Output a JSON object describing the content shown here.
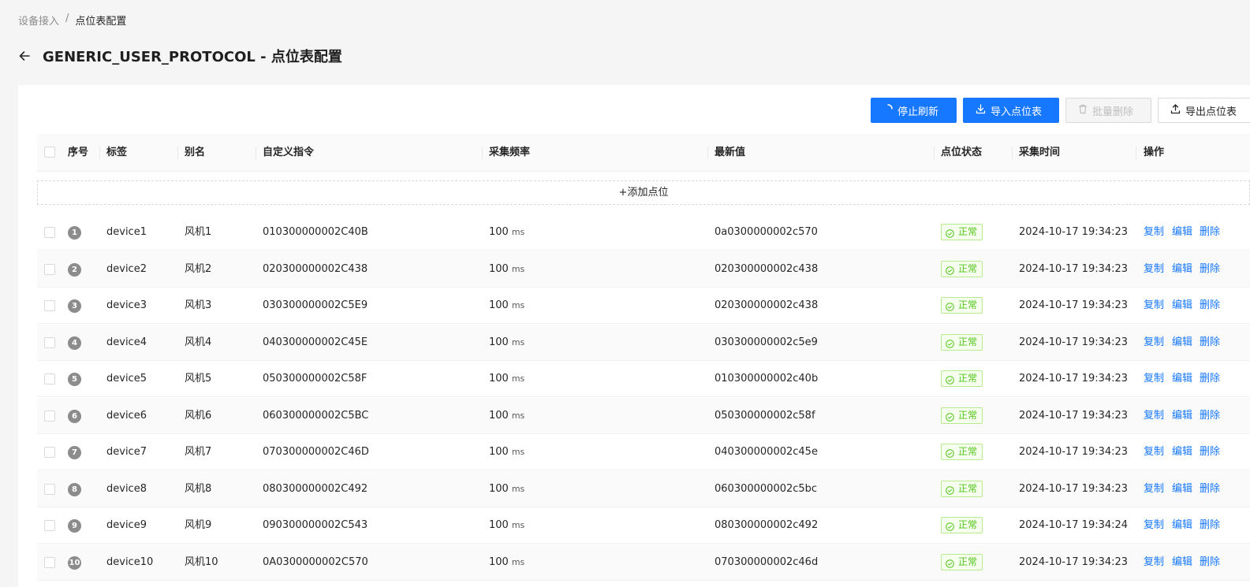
{
  "breadcrumb": {
    "parent": "设备接入",
    "separator": "/",
    "current": "点位表配置"
  },
  "page": {
    "title": "GENERIC_USER_PROTOCOL - 点位表配置"
  },
  "toolbar": {
    "stop_refresh": "停止刷新",
    "import": "导入点位表",
    "batch_delete": "批量删除",
    "export": "导出点位表"
  },
  "table": {
    "columns": [
      "序号",
      "标签",
      "别名",
      "自定义指令",
      "采集频率",
      "最新值",
      "点位状态",
      "采集时间",
      "操作"
    ],
    "add_label": "+添加点位",
    "unit": "ms",
    "actions": {
      "copy": "复制",
      "edit": "编辑",
      "delete": "删除"
    },
    "rows": [
      {
        "idx": "1",
        "tag": "device1",
        "alias": "风机1",
        "cmd": "010300000002C40B",
        "freq": "100",
        "value": "0a0300000002c570",
        "status": "正常",
        "time": "2024-10-17 19:34:23"
      },
      {
        "idx": "2",
        "tag": "device2",
        "alias": "风机2",
        "cmd": "020300000002C438",
        "freq": "100",
        "value": "020300000002c438",
        "status": "正常",
        "time": "2024-10-17 19:34:23"
      },
      {
        "idx": "3",
        "tag": "device3",
        "alias": "风机3",
        "cmd": "030300000002C5E9",
        "freq": "100",
        "value": "020300000002c438",
        "status": "正常",
        "time": "2024-10-17 19:34:23"
      },
      {
        "idx": "4",
        "tag": "device4",
        "alias": "风机4",
        "cmd": "040300000002C45E",
        "freq": "100",
        "value": "030300000002c5e9",
        "status": "正常",
        "time": "2024-10-17 19:34:23"
      },
      {
        "idx": "5",
        "tag": "device5",
        "alias": "风机5",
        "cmd": "050300000002C58F",
        "freq": "100",
        "value": "010300000002c40b",
        "status": "正常",
        "time": "2024-10-17 19:34:23"
      },
      {
        "idx": "6",
        "tag": "device6",
        "alias": "风机6",
        "cmd": "060300000002C5BC",
        "freq": "100",
        "value": "050300000002c58f",
        "status": "正常",
        "time": "2024-10-17 19:34:23"
      },
      {
        "idx": "7",
        "tag": "device7",
        "alias": "风机7",
        "cmd": "070300000002C46D",
        "freq": "100",
        "value": "040300000002c45e",
        "status": "正常",
        "time": "2024-10-17 19:34:23"
      },
      {
        "idx": "8",
        "tag": "device8",
        "alias": "风机8",
        "cmd": "080300000002C492",
        "freq": "100",
        "value": "060300000002c5bc",
        "status": "正常",
        "time": "2024-10-17 19:34:23"
      },
      {
        "idx": "9",
        "tag": "device9",
        "alias": "风机9",
        "cmd": "090300000002C543",
        "freq": "100",
        "value": "080300000002c492",
        "status": "正常",
        "time": "2024-10-17 19:34:24"
      },
      {
        "idx": "10",
        "tag": "device10",
        "alias": "风机10",
        "cmd": "0A0300000002C570",
        "freq": "100",
        "value": "070300000002c46d",
        "status": "正常",
        "time": "2024-10-17 19:34:23"
      }
    ]
  },
  "colors": {
    "primary": "#1677ff",
    "success": "#52c41a",
    "index_badge": "#8c8c8c"
  }
}
